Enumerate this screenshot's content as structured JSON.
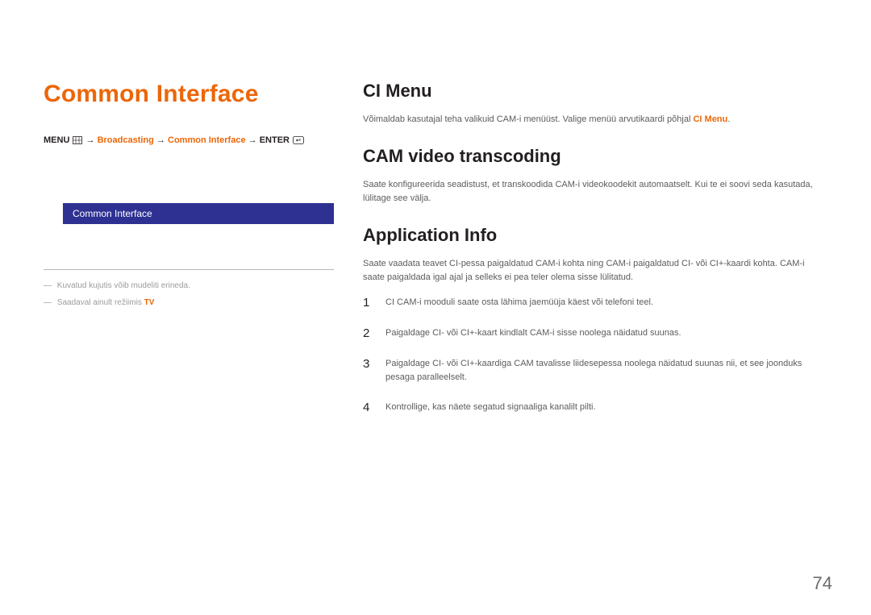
{
  "left": {
    "title": "Common Interface",
    "breadcrumb": {
      "menu": "MENU",
      "arrow": "→",
      "b1": "Broadcasting",
      "b2": "Common Interface",
      "enter": "ENTER"
    },
    "menubar_label": "Common Interface",
    "footnote1_prefix": "―  ",
    "footnote1": "Kuvatud kujutis võib mudeliti erineda.",
    "footnote2_prefix": "―  ",
    "footnote2_a": "Saadaval ainult režiimis ",
    "footnote2_tv": "TV"
  },
  "right": {
    "s1_title": "CI Menu",
    "s1_text_a": "Võimaldab kasutajal teha valikuid CAM-i menüüst. Valige menüü arvutikaardi põhjal ",
    "s1_text_b": "CI Menu",
    "s1_text_c": ".",
    "s2_title": "CAM video transcoding",
    "s2_text": "Saate konfigureerida seadistust, et transkoodida CAM-i videokoodekit automaatselt. Kui te ei soovi seda kasutada, lülitage see välja.",
    "s3_title": "Application Info",
    "s3_text": "Saate vaadata teavet CI-pessa paigaldatud CAM-i kohta ning CAM-i paigaldatud CI- või CI+-kaardi kohta. CAM-i saate paigaldada igal ajal ja selleks ei pea teler olema sisse lülitatud.",
    "steps": [
      {
        "n": "1",
        "t": "CI CAM-i mooduli saate osta lähima jaemüüja käest või telefoni teel."
      },
      {
        "n": "2",
        "t": "Paigaldage CI- või CI+-kaart kindlalt CAM-i sisse noolega näidatud suunas."
      },
      {
        "n": "3",
        "t": "Paigaldage CI- või CI+-kaardiga CAM tavalisse liidesepessa noolega näidatud suunas nii, et see joonduks pesaga paralleelselt."
      },
      {
        "n": "4",
        "t": "Kontrollige, kas näete segatud signaaliga kanalilt pilti."
      }
    ]
  },
  "page_number": "74"
}
